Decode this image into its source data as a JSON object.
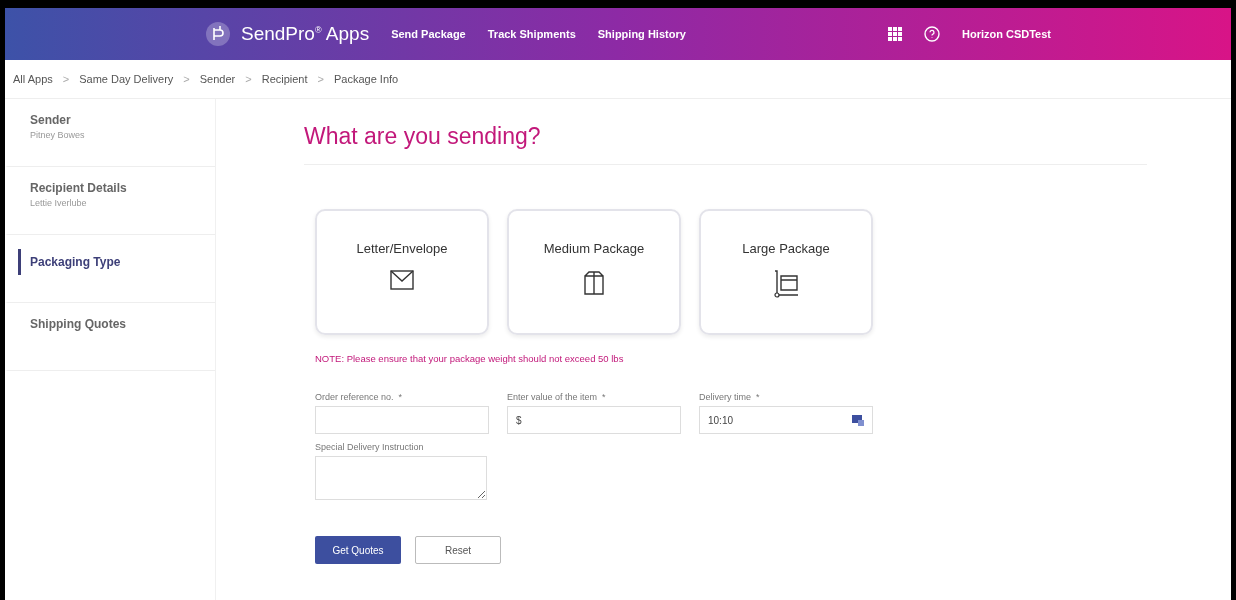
{
  "header": {
    "brand": "SendPro",
    "brand_mark": "®",
    "brand_suffix": "Apps",
    "nav": [
      {
        "label": "Send Package"
      },
      {
        "label": "Track Shipments"
      },
      {
        "label": "Shipping History"
      }
    ],
    "user": "Horizon CSDTest"
  },
  "breadcrumb": [
    "All Apps",
    "Same Day Delivery",
    "Sender",
    "Recipient",
    "Package Info"
  ],
  "breadcrumb_separator": ">",
  "sidebar": {
    "items": [
      {
        "title": "Sender",
        "subtitle": "Pitney Bowes",
        "selected": false
      },
      {
        "title": "Recipient Details",
        "subtitle": "Lettie Iverlube",
        "selected": false
      },
      {
        "title": "Packaging Type",
        "selected": true
      },
      {
        "title": "Shipping Quotes",
        "selected": false
      }
    ]
  },
  "main": {
    "title": "What are you sending?",
    "package_types": [
      {
        "label": "Letter/Envelope",
        "kind": "envelope",
        "selected": false
      },
      {
        "label": "Medium Package",
        "kind": "box",
        "selected": false
      },
      {
        "label": "Large Package",
        "kind": "cart",
        "selected": false
      }
    ],
    "note": "NOTE: Please ensure that your package weight should not exceed 50 lbs",
    "fields": [
      {
        "label": "Order reference no.",
        "required_mark": "*",
        "kind": "text"
      },
      {
        "label": "Enter value of the item",
        "required_mark": "*",
        "kind": "text",
        "value": "$"
      },
      {
        "label": "Delivery time",
        "required_mark": "*",
        "kind": "time",
        "value": "10:10"
      }
    ],
    "instruction": {
      "label": "Special Delivery Instruction"
    },
    "buttons": [
      {
        "label": "Get Quotes",
        "kind": "primary"
      },
      {
        "label": "Reset",
        "kind": "secondary"
      }
    ]
  }
}
